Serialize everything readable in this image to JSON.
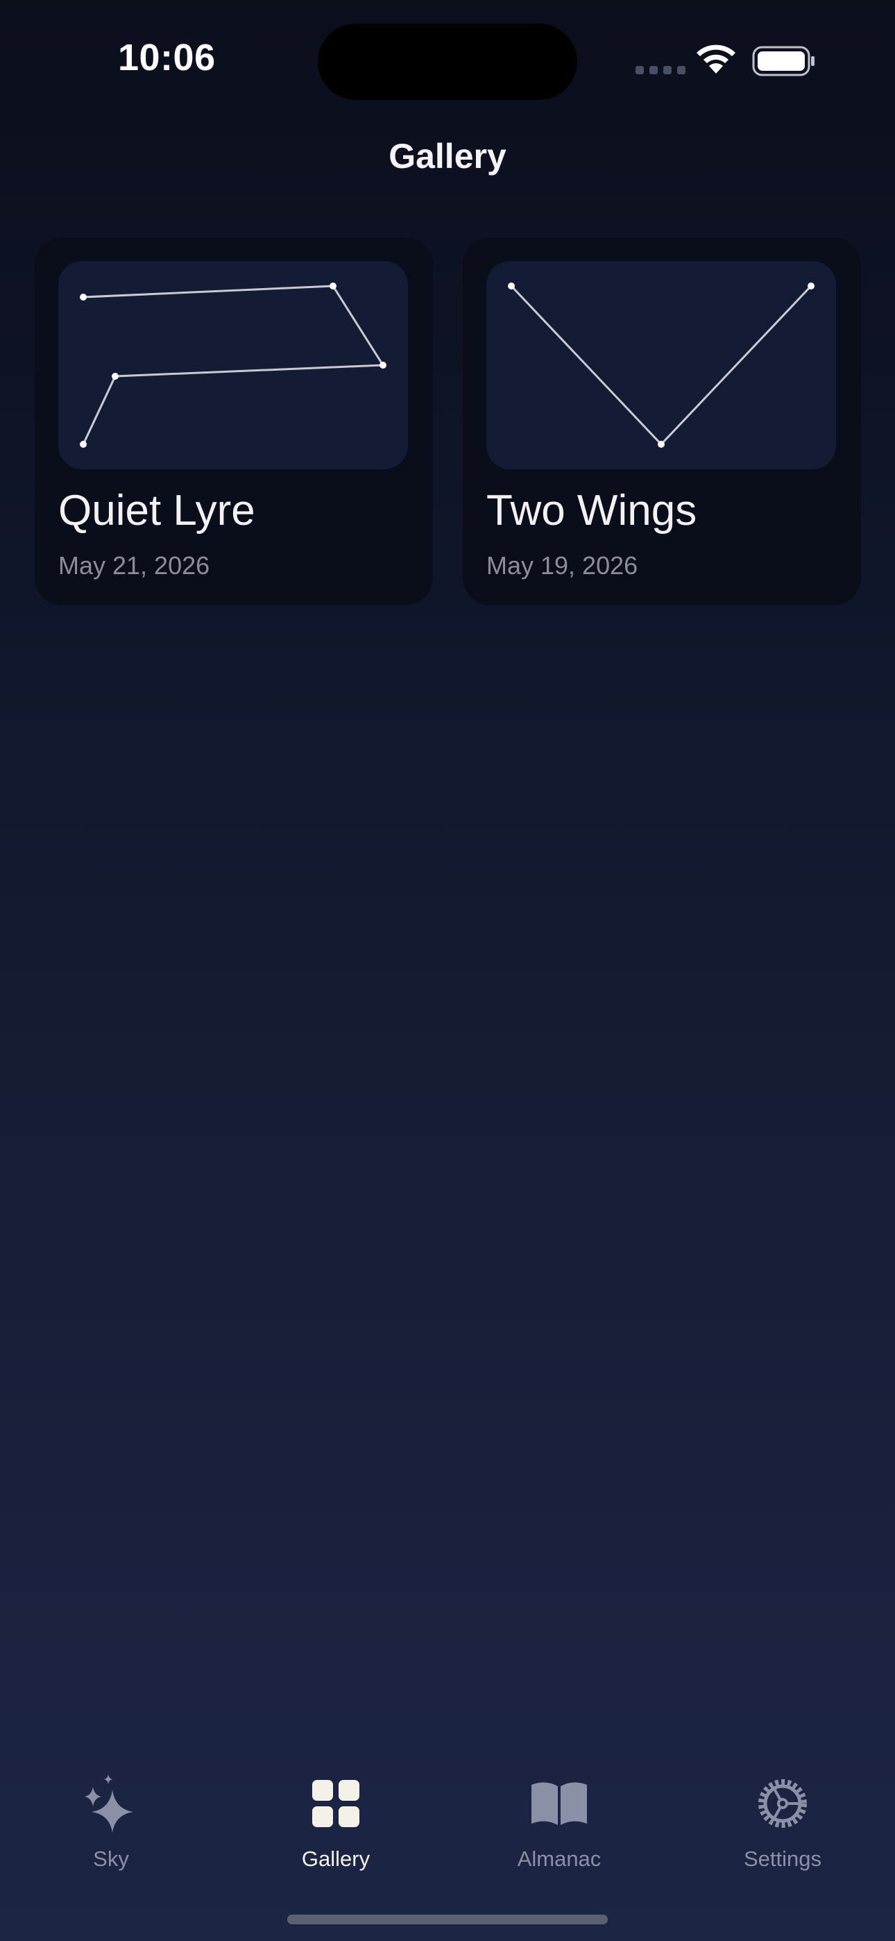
{
  "status_bar": {
    "time": "10:06"
  },
  "header": {
    "title": "Gallery"
  },
  "gallery": {
    "items": [
      {
        "name": "Quiet Lyre",
        "date": "May 21, 2026"
      },
      {
        "name": "Two Wings",
        "date": "May 19, 2026"
      }
    ]
  },
  "tabbar": {
    "tabs": [
      {
        "label": "Sky",
        "icon": "sparkle-icon"
      },
      {
        "label": "Gallery",
        "icon": "grid-icon"
      },
      {
        "label": "Almanac",
        "icon": "book-icon"
      },
      {
        "label": "Settings",
        "icon": "gear-icon"
      }
    ],
    "active": "Gallery"
  },
  "colors": {
    "accent": "#f4f1e8",
    "inactive": "#8a90a6",
    "card": "#0a0d1a",
    "thumb": "#131b35"
  }
}
